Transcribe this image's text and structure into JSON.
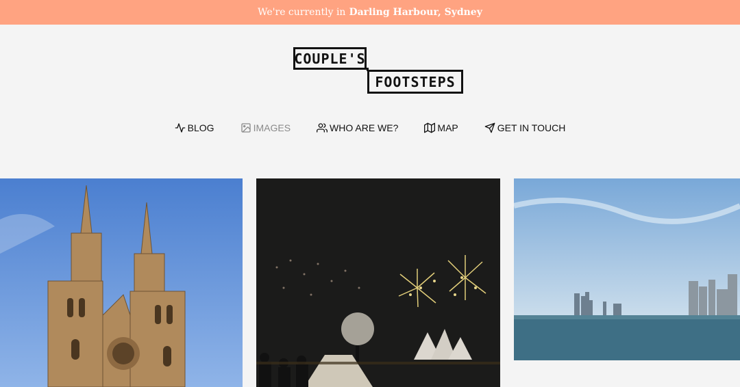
{
  "announcement": {
    "prefix": "We're currently in",
    "location": "Darling Harbour, Sydney"
  },
  "logo": {
    "line1": "COUPLE'S",
    "line2": "FOOTSTEPS"
  },
  "nav": {
    "items": [
      {
        "label": "BLOG",
        "icon": "activity-icon",
        "active": false
      },
      {
        "label": "IMAGES",
        "icon": "image-icon",
        "active": true
      },
      {
        "label": "WHO ARE WE?",
        "icon": "users-icon",
        "active": false
      },
      {
        "label": "MAP",
        "icon": "map-icon",
        "active": false
      },
      {
        "label": "GET IN TOUCH",
        "icon": "send-icon",
        "active": false
      }
    ]
  },
  "gallery": {
    "tiles": [
      {
        "subject": "cathedral photo"
      },
      {
        "subject": "fireworks over opera house photo"
      },
      {
        "subject": "harbour skyline photo"
      }
    ]
  },
  "colors": {
    "announcement_bg": "#ffa381",
    "page_bg": "#f4f4f4",
    "text": "#111111",
    "muted_nav": "#8a8a8a"
  }
}
